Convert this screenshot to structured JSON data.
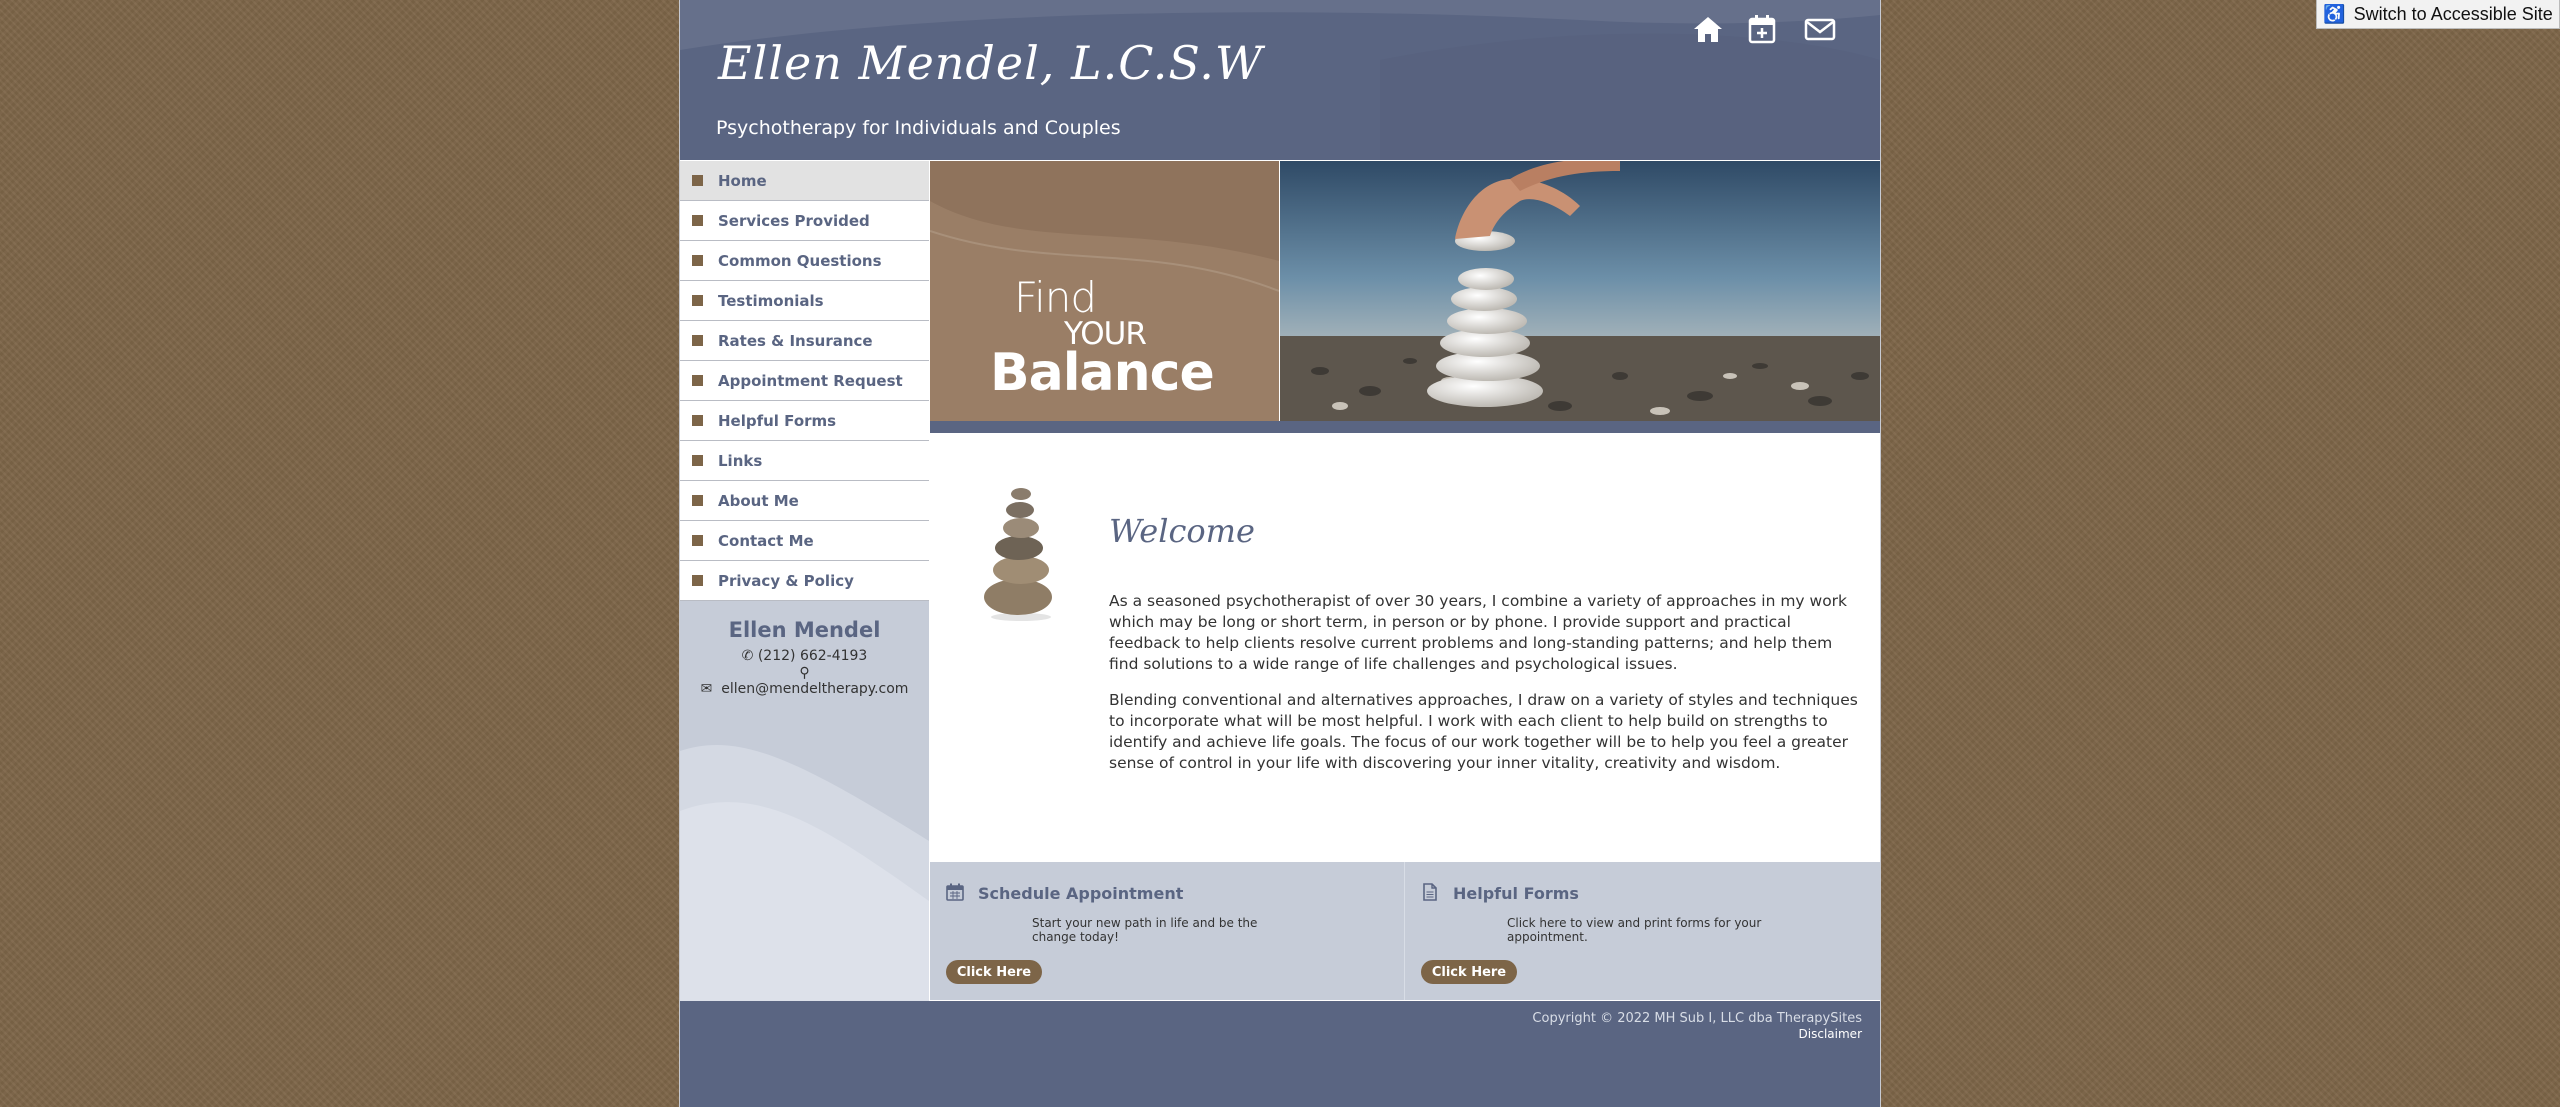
{
  "accessible": {
    "label": "Switch to Accessible Site"
  },
  "header": {
    "title": "Ellen Mendel, L.C.S.W",
    "tagline": "Psychotherapy for Individuals and Couples",
    "icons": [
      "home-icon",
      "calendar-plus-icon",
      "envelope-icon"
    ]
  },
  "nav": {
    "items": [
      {
        "label": "Home"
      },
      {
        "label": "Services Provided"
      },
      {
        "label": "Common Questions"
      },
      {
        "label": "Testimonials"
      },
      {
        "label": "Rates & Insurance"
      },
      {
        "label": "Appointment Request"
      },
      {
        "label": "Helpful Forms"
      },
      {
        "label": "Links"
      },
      {
        "label": "About Me"
      },
      {
        "label": "Contact Me"
      },
      {
        "label": "Privacy & Policy"
      }
    ]
  },
  "contact": {
    "name": "Ellen Mendel",
    "phone": "(212) 662-4193",
    "email": "ellen@mendeltherapy.com"
  },
  "banner": {
    "find": "Find",
    "your": "YOUR",
    "balance": "Balance"
  },
  "welcome": {
    "title": "Welcome",
    "paragraphs": [
      "As a seasoned psychotherapist of over 30 years, I combine a variety of approaches in my work which may be long or short term, in person or by phone. I provide support and practical feedback to help clients resolve current problems and long-standing patterns; and help them find solutions to a wide range of life challenges and psychological issues.",
      "Blending conventional and alternatives approaches, I draw on a variety of styles and techniques to incorporate what will be most helpful.  I work with each client to help build on strengths to identify and achieve life goals.  The focus of our work together will be to help you feel a greater sense of control in your life with discovering your inner vitality, creativity and wisdom."
    ]
  },
  "widgets": [
    {
      "title": "Schedule Appointment",
      "text": "Start your new path in life and be the change today!",
      "button": "Click Here",
      "icon": "calendar-icon"
    },
    {
      "title": "Helpful Forms",
      "text": "Click here to view and print forms for your appointment.",
      "button": "Click Here",
      "icon": "document-icon"
    }
  ],
  "footer": {
    "copyright": "Copyright © 2022 MH Sub I, LLC dba TherapySites",
    "disclaimer": "Disclaimer"
  },
  "colors": {
    "brand": "#5a6582",
    "accent": "#7d6548",
    "page_bg": "#7d6548"
  }
}
